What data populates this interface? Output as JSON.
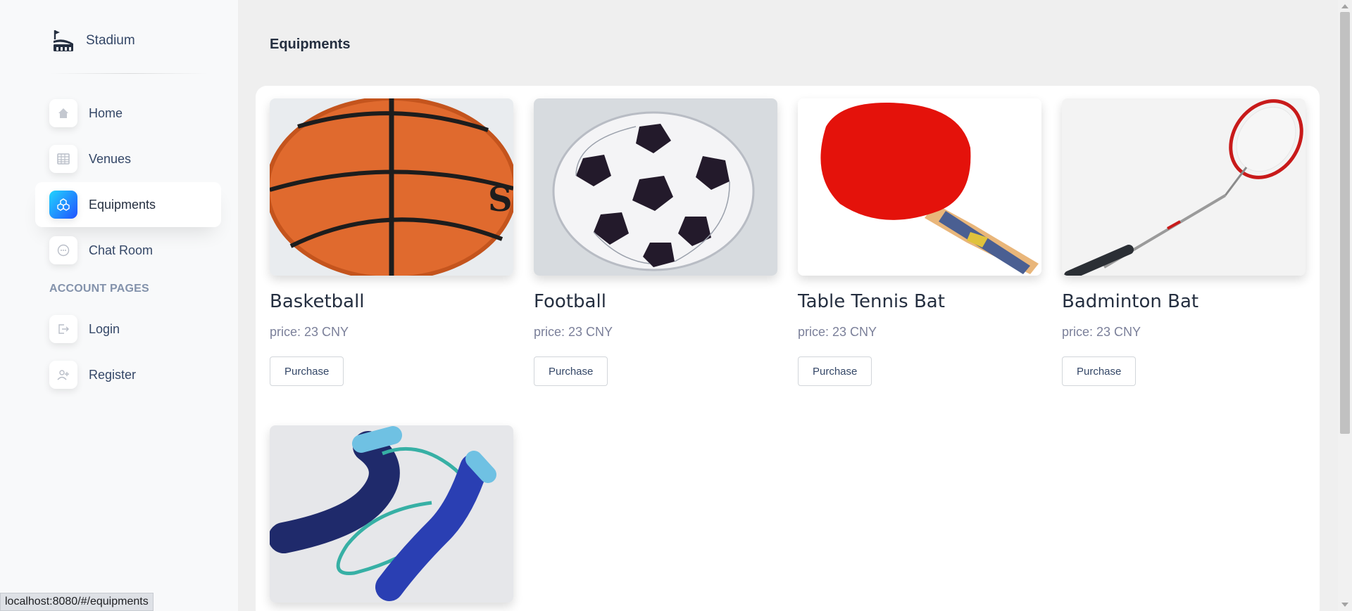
{
  "sidebar": {
    "brand": {
      "name": "Stadium",
      "icon": "stadium-icon"
    },
    "items": [
      {
        "label": "Home",
        "icon": "home-icon",
        "active": false
      },
      {
        "label": "Venues",
        "icon": "table-icon",
        "active": false
      },
      {
        "label": "Equipments",
        "icon": "cube-cluster-icon",
        "active": true
      },
      {
        "label": "Chat Room",
        "icon": "chat-icon",
        "active": false
      }
    ],
    "section_title": "ACCOUNT PAGES",
    "account_items": [
      {
        "label": "Login",
        "icon": "login-icon"
      },
      {
        "label": "Register",
        "icon": "add-user-icon"
      }
    ]
  },
  "main": {
    "title": "Equipments",
    "products": [
      {
        "name": "Basketball",
        "price": "price: 23 CNY",
        "button": "Purchase",
        "image": "basketball"
      },
      {
        "name": "Football",
        "price": "price: 23 CNY",
        "button": "Purchase",
        "image": "football"
      },
      {
        "name": "Table Tennis Bat",
        "price": "price: 23 CNY",
        "button": "Purchase",
        "image": "table-tennis-bat"
      },
      {
        "name": "Badminton Bat",
        "price": "price: 23 CNY",
        "button": "Purchase",
        "image": "badminton-bat"
      },
      {
        "name": "",
        "price": "",
        "button": "",
        "image": "jump-rope"
      }
    ]
  },
  "status_bar": {
    "url": "localhost:8080/#/equipments"
  },
  "colors": {
    "accent_gradient_start": "#2152ff",
    "accent_gradient_end": "#21d4fd",
    "text_dark": "#252f40",
    "text_muted": "#7b809a"
  }
}
